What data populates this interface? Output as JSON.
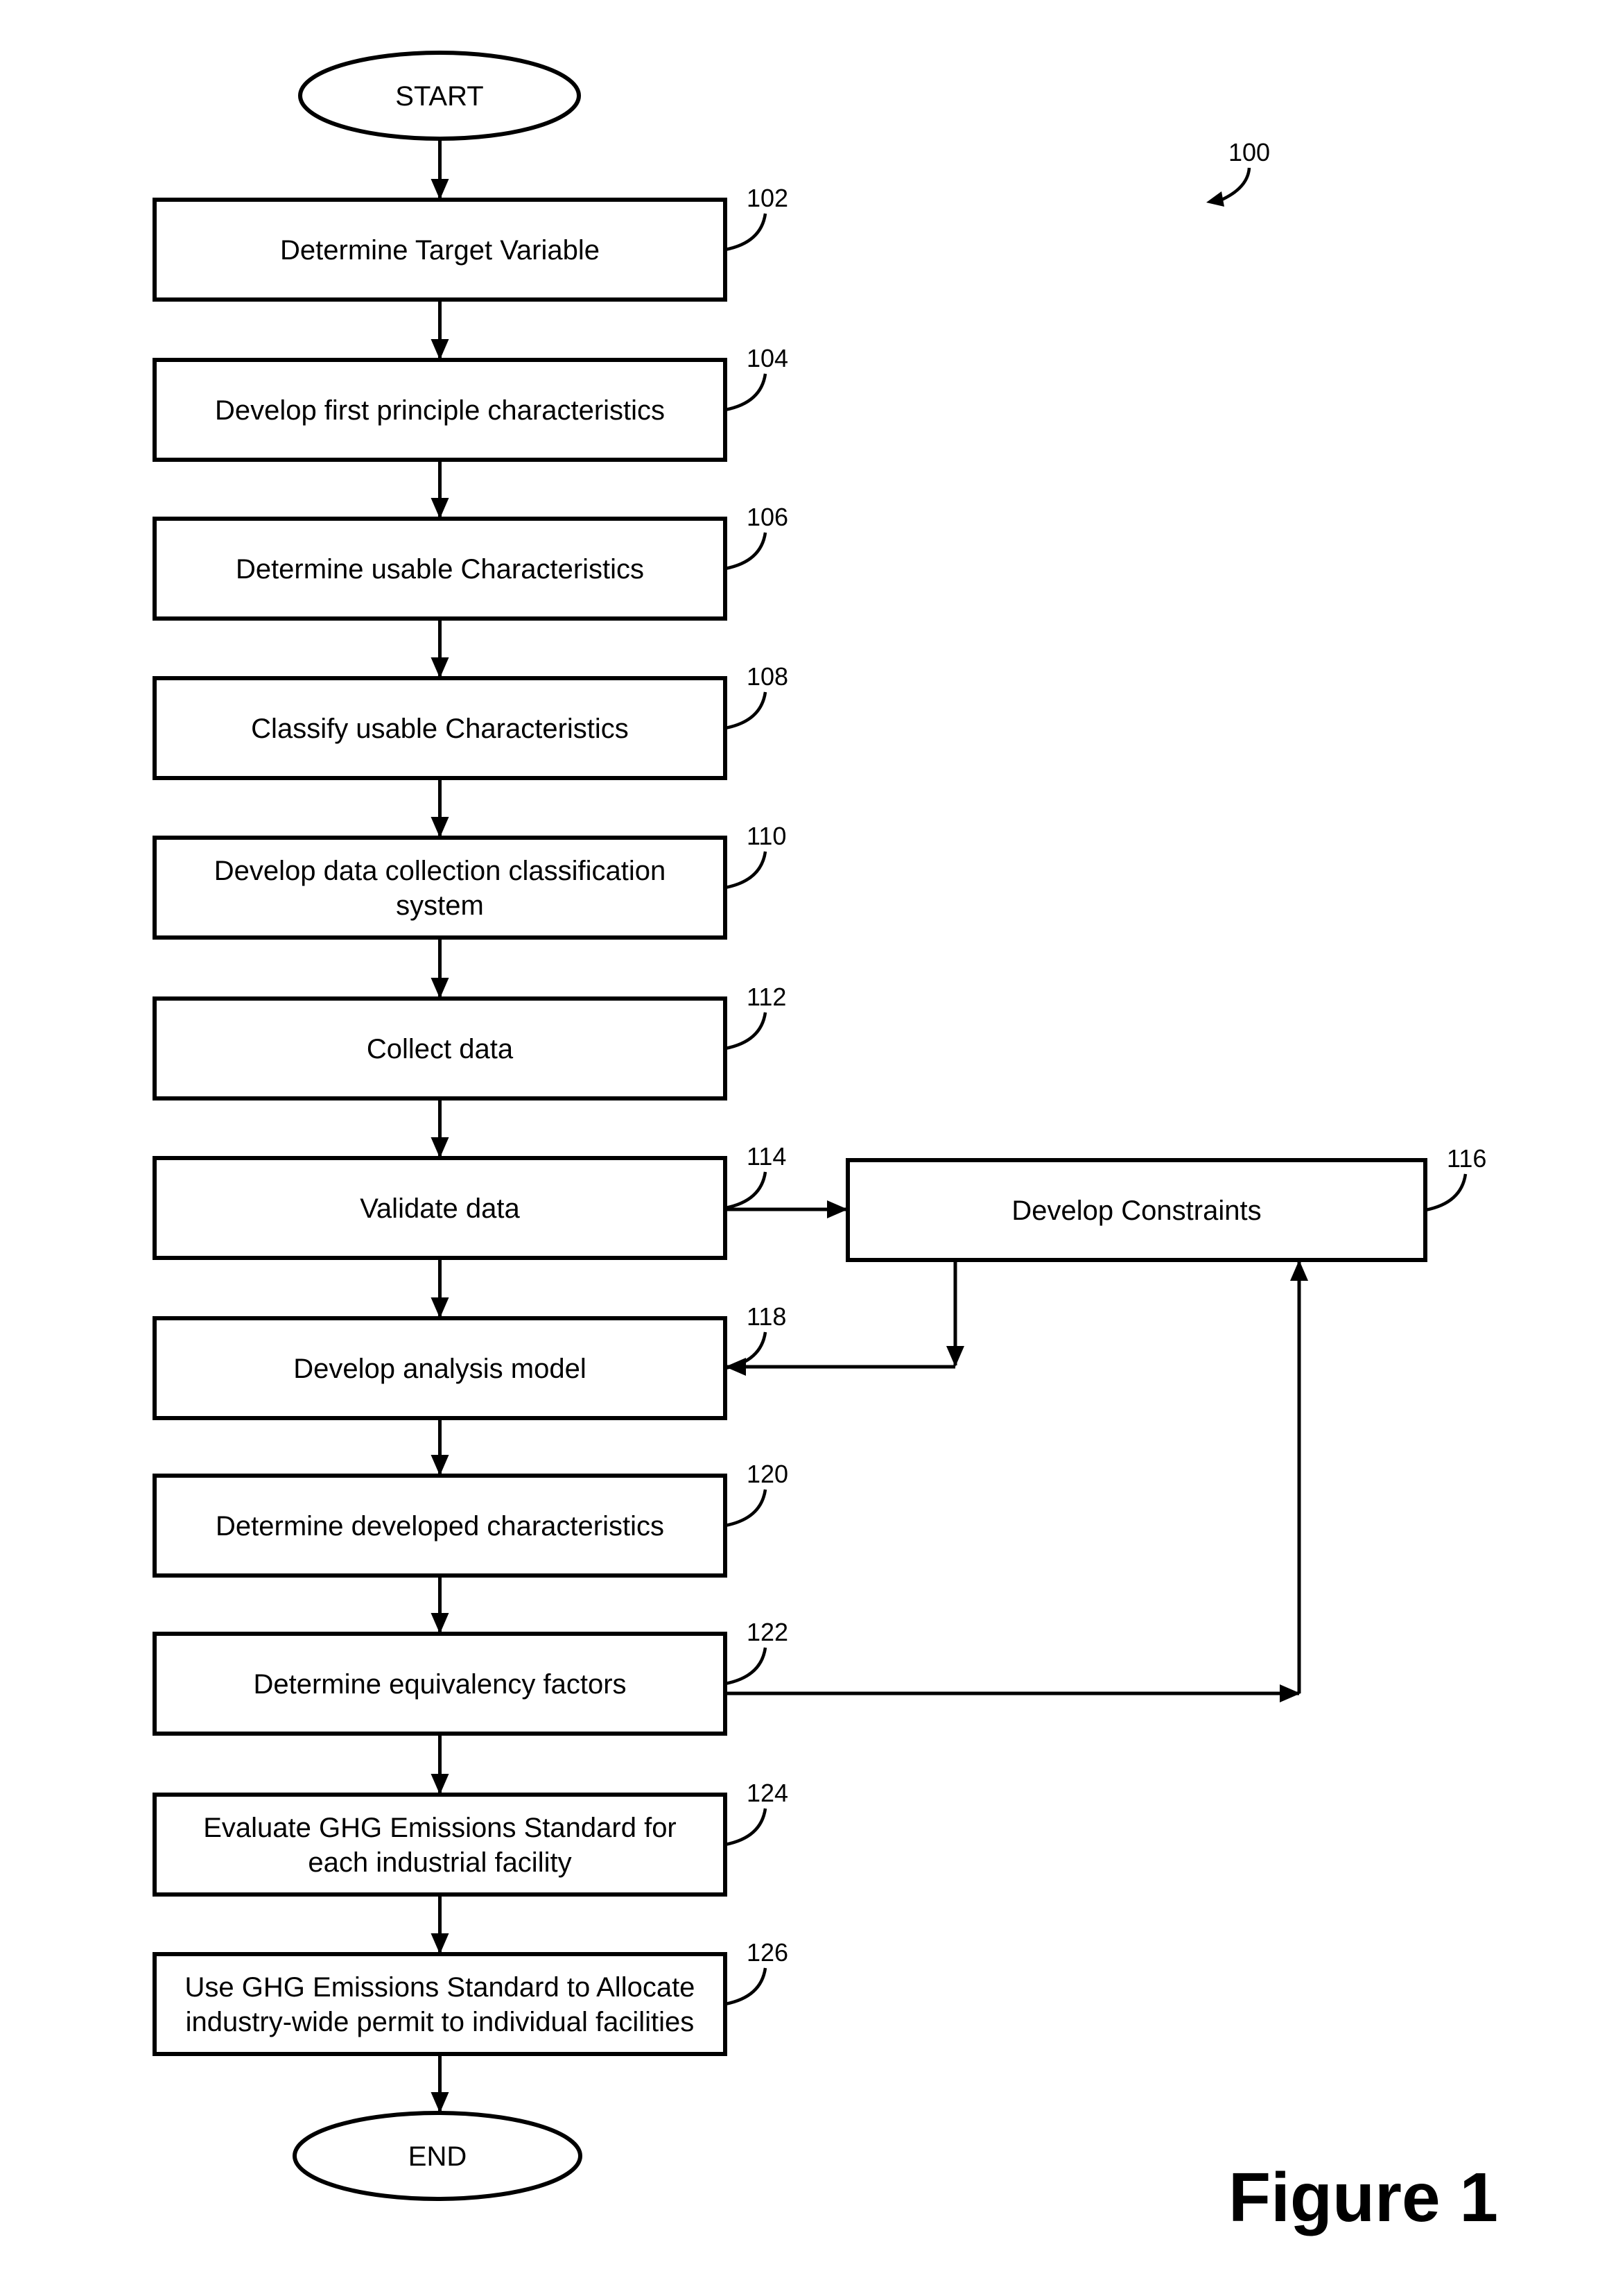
{
  "diagram": {
    "reference_number": "100",
    "figure_caption": "Figure 1",
    "start": {
      "label": "START"
    },
    "end": {
      "label": "END"
    },
    "steps": [
      {
        "id": "102",
        "lines": [
          "Determine Target Variable"
        ]
      },
      {
        "id": "104",
        "lines": [
          "Develop first principle characteristics"
        ]
      },
      {
        "id": "106",
        "lines": [
          "Determine usable Characteristics"
        ]
      },
      {
        "id": "108",
        "lines": [
          "Classify usable Characteristics"
        ]
      },
      {
        "id": "110",
        "lines": [
          "Develop data collection classification",
          "system"
        ]
      },
      {
        "id": "112",
        "lines": [
          "Collect data"
        ]
      },
      {
        "id": "114",
        "lines": [
          "Validate data"
        ]
      },
      {
        "id": "118",
        "lines": [
          "Develop analysis model"
        ]
      },
      {
        "id": "120",
        "lines": [
          "Determine developed characteristics"
        ]
      },
      {
        "id": "122",
        "lines": [
          "Determine equivalency factors"
        ]
      },
      {
        "id": "124",
        "lines": [
          "Evaluate GHG Emissions Standard for",
          "each industrial facility"
        ]
      },
      {
        "id": "126",
        "lines": [
          "Use GHG Emissions Standard to Allocate",
          "industry-wide permit to individual facilities"
        ]
      }
    ],
    "side_step": {
      "id": "116",
      "lines": [
        "Develop Constraints"
      ]
    },
    "connections": [
      {
        "from": "114",
        "to": "116"
      },
      {
        "from": "116",
        "to": "118"
      },
      {
        "from": "122",
        "to": "116"
      }
    ]
  }
}
